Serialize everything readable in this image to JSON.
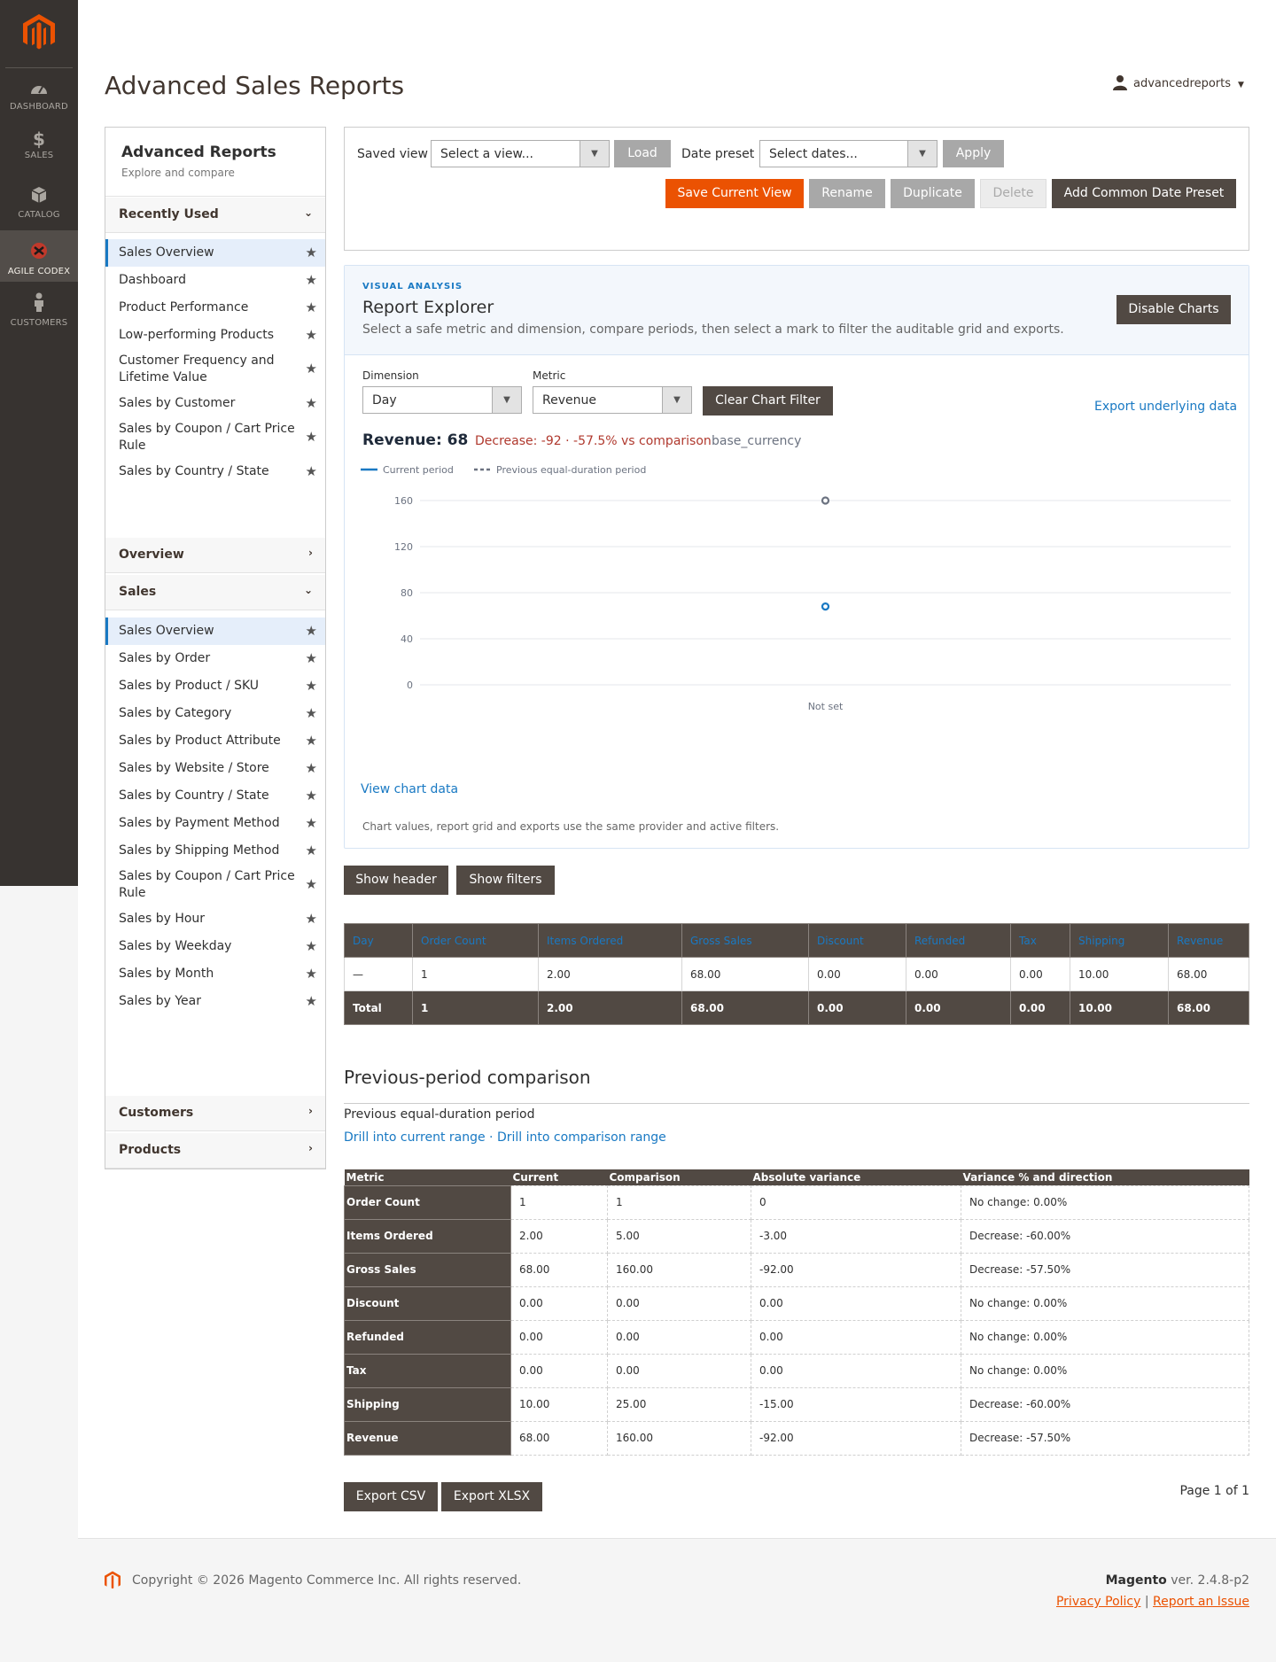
{
  "nav": {
    "items": [
      {
        "label": "DASHBOARD",
        "icon": "dashboard-icon"
      },
      {
        "label": "SALES",
        "icon": "dollar-icon"
      },
      {
        "label": "CATALOG",
        "icon": "box-icon"
      },
      {
        "label": "AGILE CODEX",
        "icon": "agile-codex-icon"
      },
      {
        "label": "CUSTOMERS",
        "icon": "person-icon"
      }
    ]
  },
  "header": {
    "title": "Advanced Sales Reports",
    "user": "advancedreports"
  },
  "sidebar": {
    "title": "Advanced Reports",
    "subtitle": "Explore and compare",
    "recent_group": "Recently Used",
    "recent": [
      "Sales Overview",
      "Dashboard",
      "Product Performance",
      "Low-performing Products",
      "Customer Frequency and Lifetime Value",
      "Sales by Customer",
      "Sales by Coupon / Cart Price Rule",
      "Sales by Country / State"
    ],
    "overview_group": "Overview",
    "sales_group": "Sales",
    "sales": [
      "Sales Overview",
      "Sales by Order",
      "Sales by Product / SKU",
      "Sales by Category",
      "Sales by Product Attribute",
      "Sales by Website / Store",
      "Sales by Country / State",
      "Sales by Payment Method",
      "Sales by Shipping Method",
      "Sales by Coupon / Cart Price Rule",
      "Sales by Hour",
      "Sales by Weekday",
      "Sales by Month",
      "Sales by Year"
    ],
    "customers_group": "Customers",
    "products_group": "Products"
  },
  "toolbar": {
    "saved_view_label": "Saved view",
    "saved_view_value": "Select a view...",
    "load": "Load",
    "date_preset_label": "Date preset",
    "date_preset_value": "Select dates...",
    "apply": "Apply",
    "save_view": "Save Current View",
    "rename": "Rename",
    "duplicate": "Duplicate",
    "delete": "Delete",
    "add_preset": "Add Common Date Preset"
  },
  "explorer": {
    "eyebrow": "VISUAL ANALYSIS",
    "title": "Report Explorer",
    "description": "Select a safe metric and dimension, compare periods, then select a mark to filter the auditable grid and exports.",
    "disable_charts": "Disable Charts",
    "dimension_label": "Dimension",
    "dimension_value": "Day",
    "metric_label": "Metric",
    "metric_value": "Revenue",
    "clear_filter": "Clear Chart Filter",
    "export_underlying": "Export underlying data",
    "summary_value": "Revenue: 68",
    "summary_change": "Decrease: -92 · -57.5% vs comparison",
    "summary_currency": "base_currency",
    "view_chart_data": "View chart data",
    "footnote": "Chart values, report grid and exports use the same provider and active filters."
  },
  "chart_data": {
    "type": "scatter",
    "categories": [
      "Not set"
    ],
    "series": [
      {
        "name": "Current period",
        "values": [
          68
        ],
        "color": "#1979c3",
        "style": "solid"
      },
      {
        "name": "Previous equal-duration period",
        "values": [
          160
        ],
        "color": "#6b7280",
        "style": "dashed"
      }
    ],
    "yticks": [
      "0",
      "40",
      "80",
      "120",
      "160"
    ],
    "ylim": [
      0,
      160
    ],
    "legend": "top-left",
    "grid": true
  },
  "buttons": {
    "show_header": "Show header",
    "show_filters": "Show filters",
    "export_csv": "Export CSV",
    "export_xlsx": "Export XLSX"
  },
  "grid": {
    "columns": [
      "Day",
      "Order Count",
      "Items Ordered",
      "Gross Sales",
      "Discount",
      "Refunded",
      "Tax",
      "Shipping",
      "Revenue"
    ],
    "rows": [
      [
        "—",
        "1",
        "2.00",
        "68.00",
        "0.00",
        "0.00",
        "0.00",
        "10.00",
        "68.00"
      ]
    ],
    "total": [
      "Total",
      "1",
      "2.00",
      "68.00",
      "0.00",
      "0.00",
      "0.00",
      "10.00",
      "68.00"
    ]
  },
  "comparison": {
    "title": "Previous-period comparison",
    "period_label": "Previous equal-duration period",
    "drill_current": "Drill into current range",
    "separator": " · ",
    "drill_comparison": "Drill into comparison range",
    "columns": [
      "Metric",
      "Current",
      "Comparison",
      "Absolute variance",
      "Variance % and direction"
    ],
    "rows": [
      [
        "Order Count",
        "1",
        "1",
        "0",
        "No change: 0.00%"
      ],
      [
        "Items Ordered",
        "2.00",
        "5.00",
        "-3.00",
        "Decrease: -60.00%"
      ],
      [
        "Gross Sales",
        "68.00",
        "160.00",
        "-92.00",
        "Decrease: -57.50%"
      ],
      [
        "Discount",
        "0.00",
        "0.00",
        "0.00",
        "No change: 0.00%"
      ],
      [
        "Refunded",
        "0.00",
        "0.00",
        "0.00",
        "No change: 0.00%"
      ],
      [
        "Tax",
        "0.00",
        "0.00",
        "0.00",
        "No change: 0.00%"
      ],
      [
        "Shipping",
        "10.00",
        "25.00",
        "-15.00",
        "Decrease: -60.00%"
      ],
      [
        "Revenue",
        "68.00",
        "160.00",
        "-92.00",
        "Decrease: -57.50%"
      ]
    ]
  },
  "pager": "Page 1 of 1",
  "footer": {
    "copyright": "Copyright © 2026 Magento Commerce Inc. All rights reserved.",
    "brand": "Magento",
    "version": " ver. 2.4.8-p2",
    "privacy": "Privacy Policy",
    "sep": " | ",
    "report": "Report an Issue"
  }
}
